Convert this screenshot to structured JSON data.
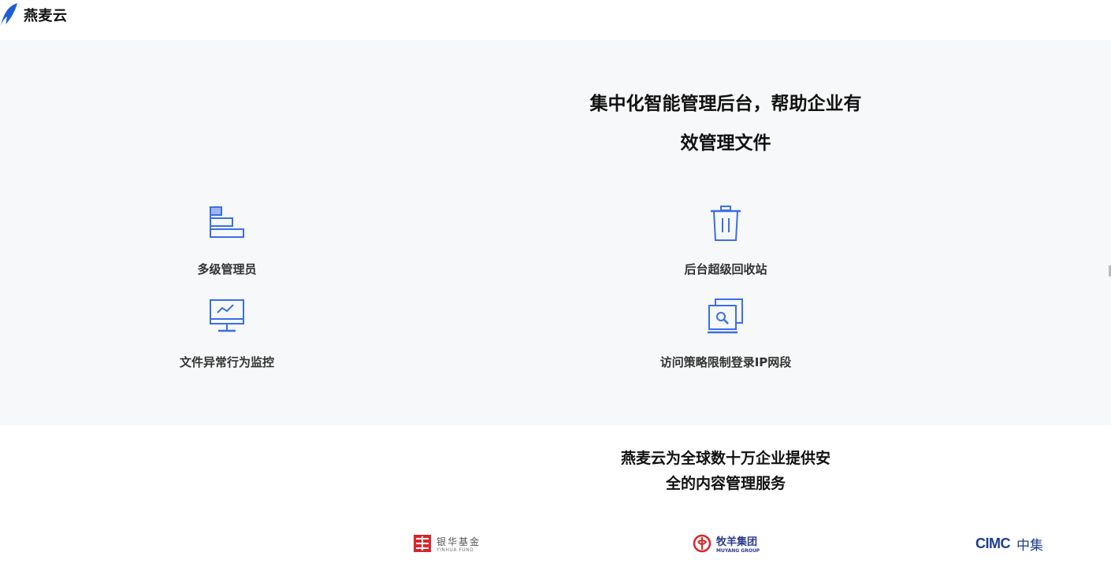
{
  "header": {
    "brand_name": "燕麦云",
    "logo_icon": "feather-logo-icon",
    "brand_color": "#1e5fd8"
  },
  "features": {
    "title_line1": "集中化智能管理后台，帮助企业有",
    "title_line2": "效管理文件",
    "items": [
      {
        "label": "多级管理员",
        "icon": "hierarchy-bars-icon"
      },
      {
        "label": "后台超级回收站",
        "icon": "trash-bin-icon"
      },
      {
        "label": "文件异常行为监控",
        "icon": "monitor-chart-icon"
      },
      {
        "label": "访问策略限制登录IP网段",
        "icon": "window-search-icon"
      }
    ],
    "accent_color": "#3a6fe8"
  },
  "clients": {
    "title_line1": "燕麦云为全球数十万企业提供安",
    "title_line2": "全的内容管理服务",
    "logos": [
      {
        "name_cn": "银华基金",
        "name_en": "YINHUA FUND",
        "color": "#d9262c"
      },
      {
        "name_cn": "牧羊集团",
        "name_en": "MUYANG GROUP",
        "color": "#d9262c"
      },
      {
        "name_en": "CIMC",
        "name_cn": "中集",
        "color": "#1e3c8c"
      }
    ]
  }
}
